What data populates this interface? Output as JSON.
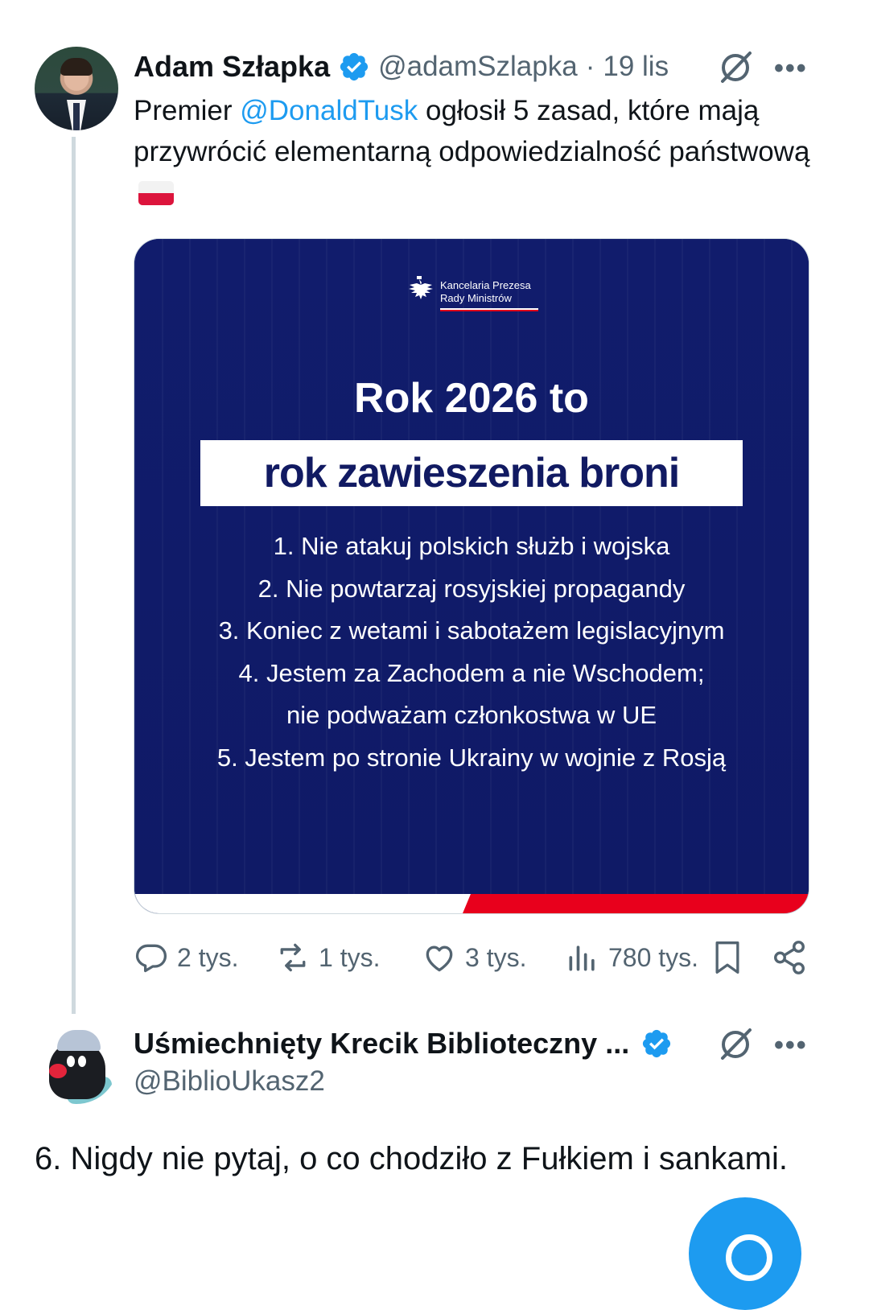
{
  "tweet": {
    "author_name": "Adam Szłapka",
    "handle": "@adamSzlapka",
    "separator": "·",
    "date": "19 lis",
    "text_before": "Premier ",
    "mention": "@DonaldTusk",
    "text_after": " ogłosił 5 zasad, które mają przywrócić elementarną odpowiedzialność państwową",
    "emoji_icon": "poland-flag-icon",
    "media": {
      "org_line1": "Kancelaria Prezesa",
      "org_line2": "Rady Ministrów",
      "headline": "Rok 2026 to",
      "banner": "rok zawieszenia broni",
      "rules": [
        "1. Nie atakuj polskich służb i wojska",
        "2. Nie powtarzaj rosyjskiej propagandy",
        "3. Koniec z wetami i sabotażem legislacyjnym",
        "4. Jestem za Zachodem a nie Wschodem;",
        "nie podważam członkostwa w UE",
        "5. Jestem po stronie Ukrainy w wojnie z Rosją"
      ],
      "colors": {
        "background": "#101b6b",
        "accent_red": "#e8001c"
      }
    },
    "actions": {
      "replies": "2 tys.",
      "reposts": "1 tys.",
      "likes": "3 tys.",
      "views": "780 tys."
    }
  },
  "reply": {
    "author_name": "Uśmiechnięty Krecik Biblioteczny ...",
    "handle": "@BiblioUkasz2",
    "text": "6. Nigdy nie pytaj, o co chodziło z Fułkiem i sankami."
  },
  "ui": {
    "more_label": "•••",
    "accent_color": "#1d9bf0",
    "text_color": "#0f1419",
    "muted_color": "#536471"
  }
}
